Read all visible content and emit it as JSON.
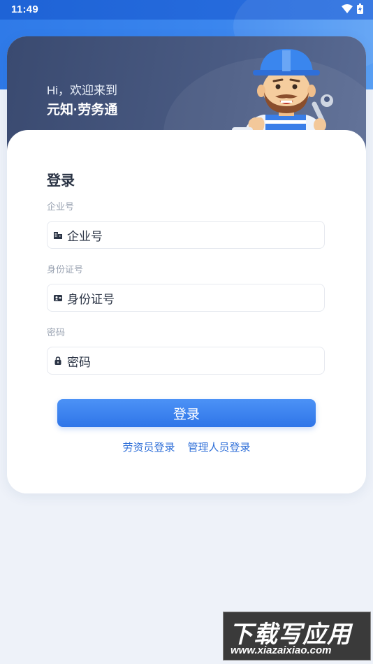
{
  "status_bar": {
    "time": "11:49"
  },
  "header": {
    "greeting": "Hi，欢迎来到",
    "app_name": "元知·劳务通"
  },
  "form": {
    "title": "登录",
    "enterprise": {
      "label": "企业号",
      "placeholder": "企业号"
    },
    "id_card": {
      "label": "身份证号",
      "placeholder": "身份证号"
    },
    "password": {
      "label": "密码",
      "placeholder": "密码"
    },
    "login_button": "登录"
  },
  "links": {
    "worker_login": "劳资员登录",
    "admin_login": "管理人员登录"
  },
  "watermark": {
    "big": "下载写应用",
    "url": "www.xiazaixiao.com"
  },
  "icons": [
    "wifi-icon",
    "battery-icon",
    "building-icon",
    "id-card-icon",
    "lock-icon"
  ],
  "colors": {
    "primary": "#2f75e8",
    "hero": "#3a4a70",
    "background": "#eef2f9"
  }
}
